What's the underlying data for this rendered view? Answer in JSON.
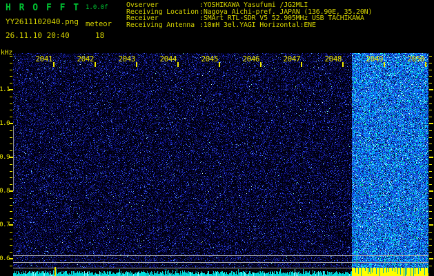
{
  "app": {
    "title": "H R O F F T",
    "version": "1.0.0f",
    "filename": "YY2611102040.png",
    "mode": "meteor",
    "datetime": "26.11.10 20:40",
    "meteor_count": "18"
  },
  "observation": {
    "rows": [
      {
        "label": "Ovserver",
        "value": ":YOSHIKAWA Yasufumi /JG2MLI"
      },
      {
        "label": "Receiving Location",
        "value": ":Nagoya Aichi-pref. JAPAN (136.90E, 35.20N)"
      },
      {
        "label": "Receiver",
        "value": ":SMArt RTL-SDR V5 52.905MHz USB TACHIKAWA"
      },
      {
        "label": "Receiving Antenna",
        "value": ":10mH 3el.YAGI Horizontal:ENE"
      }
    ]
  },
  "chart_data": {
    "type": "heatmap",
    "title": "HROFFT 10-minute radio meteor spectrogram",
    "ylabel": "kHz",
    "y_tick_labels": [
      "1.1",
      "1.0",
      "0.9",
      "0.8",
      "0.7",
      "0.6"
    ],
    "y_range_khz": [
      0.57,
      1.21
    ],
    "x_tick_labels": [
      "2041",
      "2042",
      "2043",
      "2044",
      "2045",
      "2046",
      "2047",
      "2048",
      "2049",
      "2050"
    ],
    "x_range_hhmm": [
      "2040",
      "2050"
    ],
    "grid": false,
    "legend_position": "none",
    "regions": [
      {
        "name": "background-noise",
        "x_from": "2040",
        "x_to": "2048.2",
        "appearance": "sparse dark blue noise speckle"
      },
      {
        "name": "strong-interference",
        "x_from": "2048.2",
        "x_to": "2050",
        "appearance": "dense bright blue/cyan noise"
      }
    ],
    "reference_lines_khz": [
      0.61,
      0.59,
      0.574
    ],
    "signal_level_bar": {
      "left_segment": "low level (cyan bars)",
      "right_segment": "saturated (solid yellow)",
      "transition_time": "2048.2",
      "minute_marker_time": "2041.0"
    }
  },
  "colors": {
    "title_green": "#00c232",
    "text_yellow": "#d6d400",
    "axis_yellow": "#eee800",
    "bar_cyan": "#00dcdc",
    "bar_saturated_yellow": "#ffff00",
    "reference_gray": "#b0b0b0",
    "background": "#000000"
  }
}
